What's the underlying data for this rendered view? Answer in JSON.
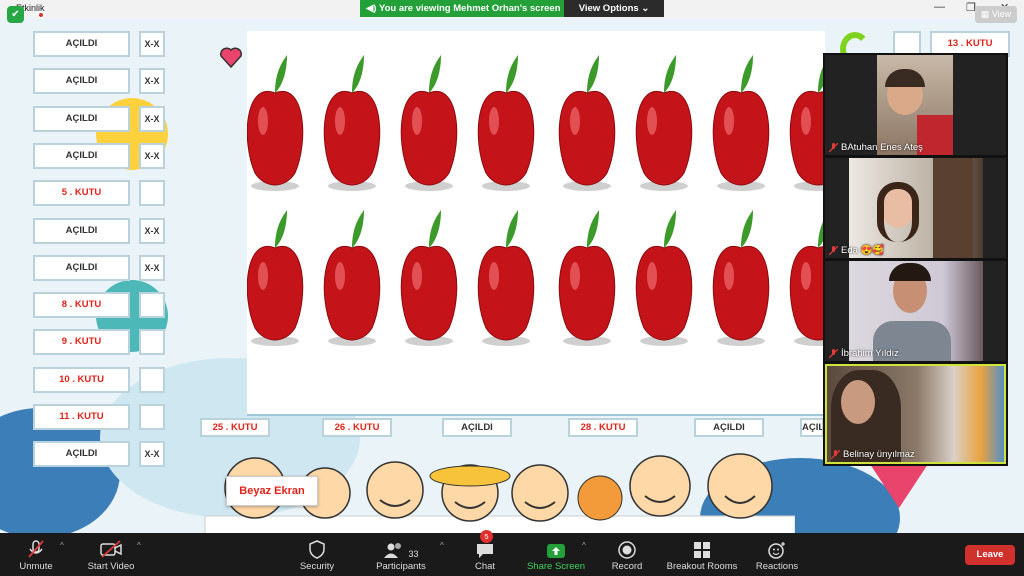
{
  "window": {
    "title": "Etkinlik",
    "sharing_banner": "You are viewing Mehmet Orhan's screen",
    "view_options": "View Options",
    "view_button": "View"
  },
  "left_column": [
    {
      "label": "AÇILDI",
      "mark": "X-X"
    },
    {
      "label": "AÇILDI",
      "mark": "X-X"
    },
    {
      "label": "AÇILDI",
      "mark": "X-X"
    },
    {
      "label": "AÇILDI",
      "mark": "X-X"
    },
    {
      "label": "5 . KUTU",
      "mark": ""
    },
    {
      "label": "AÇILDI",
      "mark": "X-X"
    },
    {
      "label": "AÇILDI",
      "mark": "X-X"
    },
    {
      "label": "8 . KUTU",
      "mark": ""
    },
    {
      "label": "9 . KUTU",
      "mark": ""
    },
    {
      "label": "10 . KUTU",
      "mark": ""
    },
    {
      "label": "11 . KUTU",
      "mark": ""
    },
    {
      "label": "AÇILDI",
      "mark": "X-X"
    }
  ],
  "bottom_row": [
    "25 . KUTU",
    "26 . KUTU",
    "AÇILDI",
    "28 . KUTU",
    "AÇILDI",
    "AÇIL"
  ],
  "top_right_box": "13 . KUTU",
  "beyaz_ekran": "Beyaz Ekran",
  "apples": {
    "count_per_row": 8,
    "rows": 2
  },
  "participants": [
    {
      "name": "BAtuhan Enes Ateş",
      "muted": true
    },
    {
      "name": "Eda 😍🥰",
      "muted": true
    },
    {
      "name": "İbrahim Yıldız",
      "muted": true
    },
    {
      "name": "Belinay ünyılmaz",
      "muted": true
    }
  ],
  "toolbar": {
    "unmute": "Unmute",
    "start_video": "Start Video",
    "security": "Security",
    "participants": "Participants",
    "participants_count": "33",
    "chat": "Chat",
    "chat_badge": "5",
    "share_screen": "Share Screen",
    "record": "Record",
    "breakout_rooms": "Breakout Rooms",
    "reactions": "Reactions",
    "leave": "Leave"
  },
  "colors": {
    "share_green": "#23a038",
    "leave_red": "#d0312d",
    "kutu_red": "#e2231a"
  }
}
